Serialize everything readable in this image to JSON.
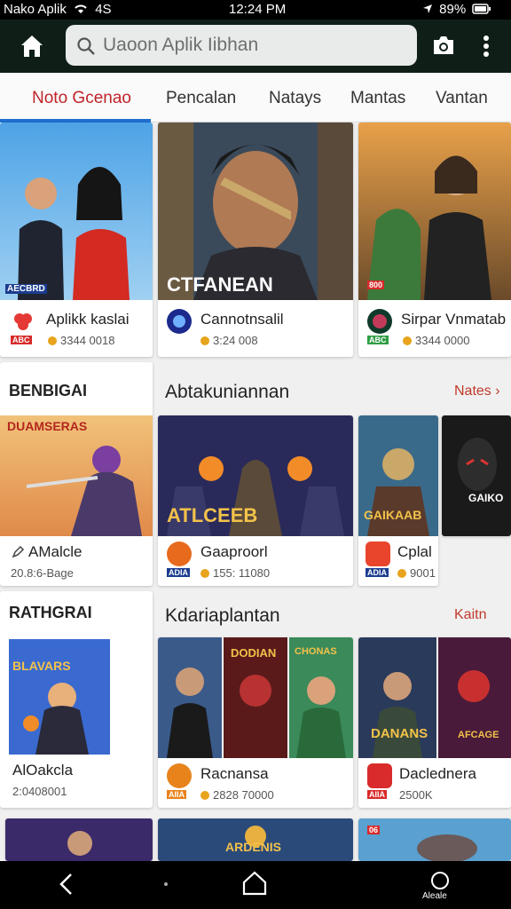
{
  "status_bar": {
    "carrier": "Nako Aplik",
    "network": "4S",
    "time": "12:24 PM",
    "battery": "89%",
    "icons": [
      "wifi-icon",
      "location-icon",
      "battery-icon"
    ]
  },
  "app_bar": {
    "search_placeholder": "Uaoon Aplik Iibhan",
    "icons": [
      "home-icon",
      "search-icon",
      "camera-icon",
      "more-vert-icon"
    ]
  },
  "tabs": [
    {
      "label": "Noto Gcenao",
      "active": true
    },
    {
      "label": "Pencalan",
      "active": false
    },
    {
      "label": "Natays",
      "active": false
    },
    {
      "label": "Mantas",
      "active": false
    },
    {
      "label": "Vantan",
      "active": false
    }
  ],
  "top_row": [
    {
      "name": "Aplikk kaslai",
      "meta": "3344 0018",
      "thumb_caption": "AECBRD",
      "rank": "ABC"
    },
    {
      "name": "Cannotnsalil",
      "meta": "3:24 008",
      "thumb_caption": "CTFANEAN",
      "rank": ""
    },
    {
      "name": "Sirpar Vnmatab",
      "meta": "3344 0000",
      "thumb_caption": "800",
      "rank": "ABC"
    }
  ],
  "section_1": {
    "side_label": "BENBIGAI",
    "title": "Abtakuniannan",
    "more": "Nates",
    "side_card": {
      "name": "AMalcle",
      "meta": "20.8:6-Bage",
      "thumb_caption": "DUAMSERAS"
    },
    "cards": [
      {
        "name": "Gaaproorl",
        "meta": "155: 11080",
        "thumb_caption": "ATLCEEB",
        "rank": "ADIA"
      },
      {
        "name": "Cplal",
        "meta": "9001",
        "thumb_caption": "GAIKAAB",
        "rank": "ADIA"
      },
      {
        "name": "",
        "meta": "",
        "thumb_caption": "GAIKO"
      }
    ]
  },
  "section_2": {
    "side_label": "RATHGRAI",
    "title": "Kdariaplantan",
    "more": "Kaitn",
    "side_card": {
      "name": "AlOakcla",
      "meta": "2:0408001",
      "thumb_caption": "BLAVARS"
    },
    "cards": [
      {
        "name": "Racnansa",
        "meta": "2828 70000",
        "rank": "AIIA"
      },
      {
        "name": "Daclednera",
        "meta": "2500K",
        "rank": "AIIA"
      }
    ],
    "thumb_captions": [
      "",
      "DODIAN",
      "CHONAS",
      "DANANS",
      "AFCAGE"
    ]
  },
  "bottom_thumbs": [
    "",
    "ARDENIS",
    "06"
  ],
  "nav_bar": {
    "assist_label": "Aleale",
    "icons": [
      "back-icon",
      "home-nav-icon",
      "assistant-icon"
    ]
  },
  "colors": {
    "accent_red": "#c0242a",
    "tab_indicator": "#1e6fd0",
    "app_bar": "#0f1f18",
    "coin": "#e7a41c"
  }
}
